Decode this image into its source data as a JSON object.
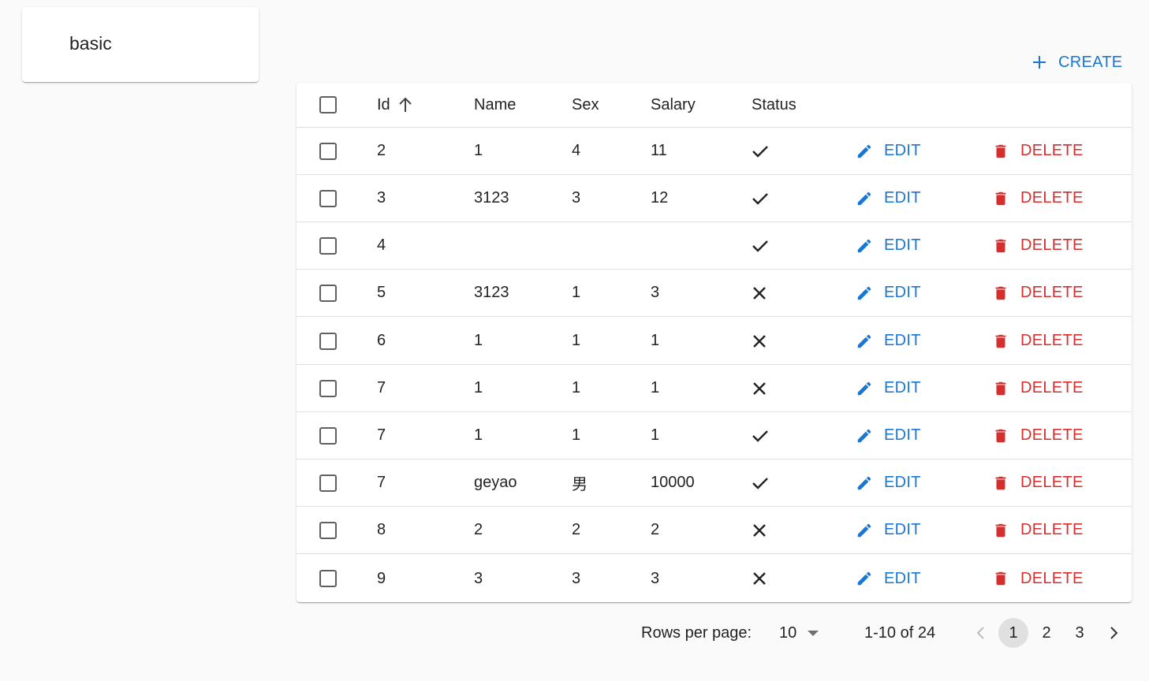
{
  "menu": {
    "items": [
      {
        "label": "basic"
      }
    ]
  },
  "toolbar": {
    "create_label": "CREATE"
  },
  "table": {
    "columns": {
      "id": "Id",
      "name": "Name",
      "sex": "Sex",
      "salary": "Salary",
      "status": "Status"
    },
    "sort": {
      "column": "Id",
      "direction": "ascending",
      "icon": "arrow-up-icon"
    },
    "edit_label": "EDIT",
    "delete_label": "DELETE",
    "rows": [
      {
        "id": "2",
        "name": "1",
        "sex": "4",
        "salary": "11",
        "status": "check"
      },
      {
        "id": "3",
        "name": "3123",
        "sex": "3",
        "salary": "12",
        "status": "check"
      },
      {
        "id": "4",
        "name": "",
        "sex": "",
        "salary": "",
        "status": "check"
      },
      {
        "id": "5",
        "name": "3123",
        "sex": "1",
        "salary": "3",
        "status": "close"
      },
      {
        "id": "6",
        "name": "1",
        "sex": "1",
        "salary": "1",
        "status": "close"
      },
      {
        "id": "7",
        "name": "1",
        "sex": "1",
        "salary": "1",
        "status": "close"
      },
      {
        "id": "7",
        "name": "1",
        "sex": "1",
        "salary": "1",
        "status": "check"
      },
      {
        "id": "7",
        "name": "geyao",
        "sex": "男",
        "salary": "10000",
        "status": "check"
      },
      {
        "id": "8",
        "name": "2",
        "sex": "2",
        "salary": "2",
        "status": "close"
      },
      {
        "id": "9",
        "name": "3",
        "sex": "3",
        "salary": "3",
        "status": "close"
      }
    ]
  },
  "pagination": {
    "rows_per_page_label": "Rows per page:",
    "rows_per_page": "10",
    "range": "1-10 of 24",
    "pages": [
      "1",
      "2",
      "3"
    ],
    "current_page": "1"
  },
  "colors": {
    "primary": "#1976d2",
    "danger": "#d32f2f",
    "background": "#fafafa"
  }
}
